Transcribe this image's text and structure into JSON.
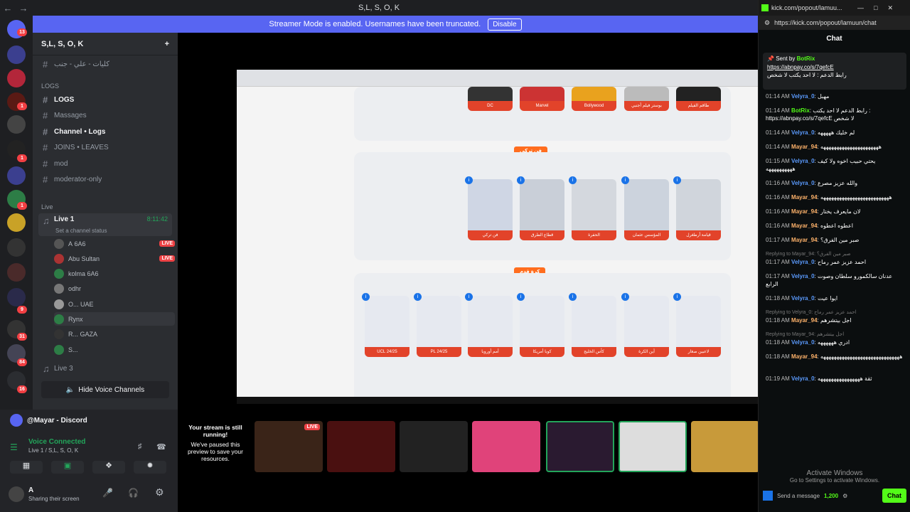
{
  "window": {
    "title": "S,L, S, O, K",
    "back": "←",
    "forward": "→"
  },
  "banner": {
    "text": "Streamer Mode is enabled. Usernames have been truncated.",
    "button": "Disable"
  },
  "server": {
    "name": "S,L, S, O, K"
  },
  "rail_badges": [
    "13",
    "1",
    "1",
    "1",
    "9",
    "31",
    "84",
    "16"
  ],
  "channels": [
    {
      "name": "كليات - علي - جنب",
      "bright": false
    },
    {
      "name": "LOGS",
      "bright": true
    },
    {
      "name": "Massages",
      "bright": false
    },
    {
      "name": "Channel • Logs",
      "bright": true
    },
    {
      "name": "JOINS • LEAVES",
      "bright": false
    },
    {
      "name": "mod",
      "bright": false
    },
    {
      "name": "moderator-only",
      "bright": false
    }
  ],
  "categories": {
    "logs": "LOGS",
    "live": "Live"
  },
  "voice": {
    "channel_name": "Live 1",
    "status_placeholder": "Set a channel status",
    "timer": "8:11:42",
    "users": [
      {
        "name": "A",
        "extra": "6A6",
        "live": true
      },
      {
        "name": "Abu Sultan",
        "extra": "",
        "live": true
      },
      {
        "name": "kolma",
        "extra": "6A6",
        "live": false
      },
      {
        "name": "odhr",
        "extra": "",
        "live": false
      },
      {
        "name": "O...",
        "extra": "UAE",
        "live": false
      },
      {
        "name": "Rynx",
        "extra": "",
        "live": false
      },
      {
        "name": "R...",
        "extra": "GAZA",
        "live": false
      },
      {
        "name": "S...",
        "extra": "",
        "live": false
      }
    ],
    "channel3": "Live 3",
    "live_badge": "LIVE",
    "hide_button": "Hide Voice Channels"
  },
  "user_panel": {
    "app": "@Mayar - Discord",
    "voice_connected": "Voice Connected",
    "voice_location": "Live 1 / S,L, S, O, K",
    "username": "A",
    "status": "Sharing their screen"
  },
  "stream": {
    "sections": [
      {
        "title": "فن تركي",
        "cards": [
          "فن تركي",
          "قطاع الطرق",
          "الحفرة",
          "المؤسس عثمان",
          "قيامة أرطغرل"
        ]
      },
      {
        "title": "كرة قدم",
        "cards": [
          "UCL 24/25",
          "PL 24/25",
          "أمم أوروبا",
          "كوبا أمريكا",
          "كأس الخليج",
          "أين الكرة",
          "لاعبين صغار"
        ]
      }
    ],
    "top_cards": [
      "DC",
      "Marvel",
      "Bollywood",
      "بوستر فيلم أجنبي",
      "طاقم الفيلم"
    ],
    "paused_title": "Your stream is still running!",
    "paused_text": "We've paused this preview to save your resources.",
    "live_badge": "LIVE"
  },
  "kick": {
    "tab_title": "kick.com/popout/lamuu...",
    "url": "https://kick.com/popout/lamuun/chat",
    "chat_title": "Chat",
    "pinned_by": "Sent by",
    "pinned_user": "BotRix",
    "pinned_link": "https://abnpay.co/s/7qefcE",
    "pinned_text": "رابط الدعم : لا احد يكتب لا شخص",
    "messages": [
      {
        "time": "01:14 AM",
        "user": "Velyra_0",
        "color": "#5b9bff",
        "text": "مهبل"
      },
      {
        "time": "01:14 AM",
        "user": "BotRix",
        "color": "#53fc18",
        "text": "رابط الدعم لا احد يكتب : https://abnpay.co/s/7qefcE لا شخص"
      },
      {
        "time": "01:14 AM",
        "user": "Velyra_0",
        "color": "#5b9bff",
        "text": "لم خليك هههههه"
      },
      {
        "time": "01:14 AM",
        "user": "Mayar_94",
        "color": "#ffb36b",
        "text": "ههههههههههههههههههههههه"
      },
      {
        "time": "01:15 AM",
        "user": "Velyra_0",
        "color": "#5b9bff",
        "text": "يحتي حبيب اخوه ولا كيف ههههههههههه"
      },
      {
        "time": "01:16 AM",
        "user": "Velyra_0",
        "color": "#5b9bff",
        "text": "والله عزيز مصرع"
      },
      {
        "time": "01:16 AM",
        "user": "Mayar_94",
        "color": "#ffb36b",
        "text": "ههههههههههههههههههههههههههه"
      },
      {
        "time": "01:16 AM",
        "user": "Mayar_94",
        "color": "#ffb36b",
        "text": "لان مايعرف يختار"
      },
      {
        "time": "01:16 AM",
        "user": "Mayar_94",
        "color": "#ffb36b",
        "text": "اعطوه اعطوه"
      },
      {
        "time": "01:17 AM",
        "user": "Mayar_94",
        "color": "#ffb36b",
        "text": "صبر مين الفرق؟"
      },
      {
        "time": "01:17 AM",
        "user": "Velyra_0",
        "color": "#5b9bff",
        "text": "احمد عزيز عمر رماح",
        "reply": "Replying to Mayar_94: صبر مين الفرق؟"
      },
      {
        "time": "01:17 AM",
        "user": "Velyra_0",
        "color": "#5b9bff",
        "text": "عدنان سالكمورو سلطان وصوت الرابع"
      },
      {
        "time": "01:18 AM",
        "user": "Velyra_0",
        "color": "#5b9bff",
        "text": "ايوا عيت"
      },
      {
        "time": "01:18 AM",
        "user": "Mayar_94",
        "color": "#ffb36b",
        "text": "اجل بيتشرهم",
        "reply": "Replying to Velyra_0: احمد عزيز عمر رماح"
      },
      {
        "time": "01:18 AM",
        "user": "Velyra_0",
        "color": "#5b9bff",
        "text": "ادري ههههههه",
        "reply": "Replying to Mayar_94: اجل بيتشرهم"
      },
      {
        "time": "01:18 AM",
        "user": "Mayar_94",
        "color": "#ffb36b",
        "text": "ههههههههههههههههههههههههههههههه"
      },
      {
        "time": "01:19 AM",
        "user": "Velyra_0",
        "color": "#5b9bff",
        "text": "ثقة ههههههههههههههههه"
      }
    ],
    "input_placeholder": "Send a message",
    "points": "1,200",
    "chat_button": "Chat",
    "watermark_line1": "Activate Windows",
    "watermark_line2": "Go to Settings to activate Windows."
  }
}
